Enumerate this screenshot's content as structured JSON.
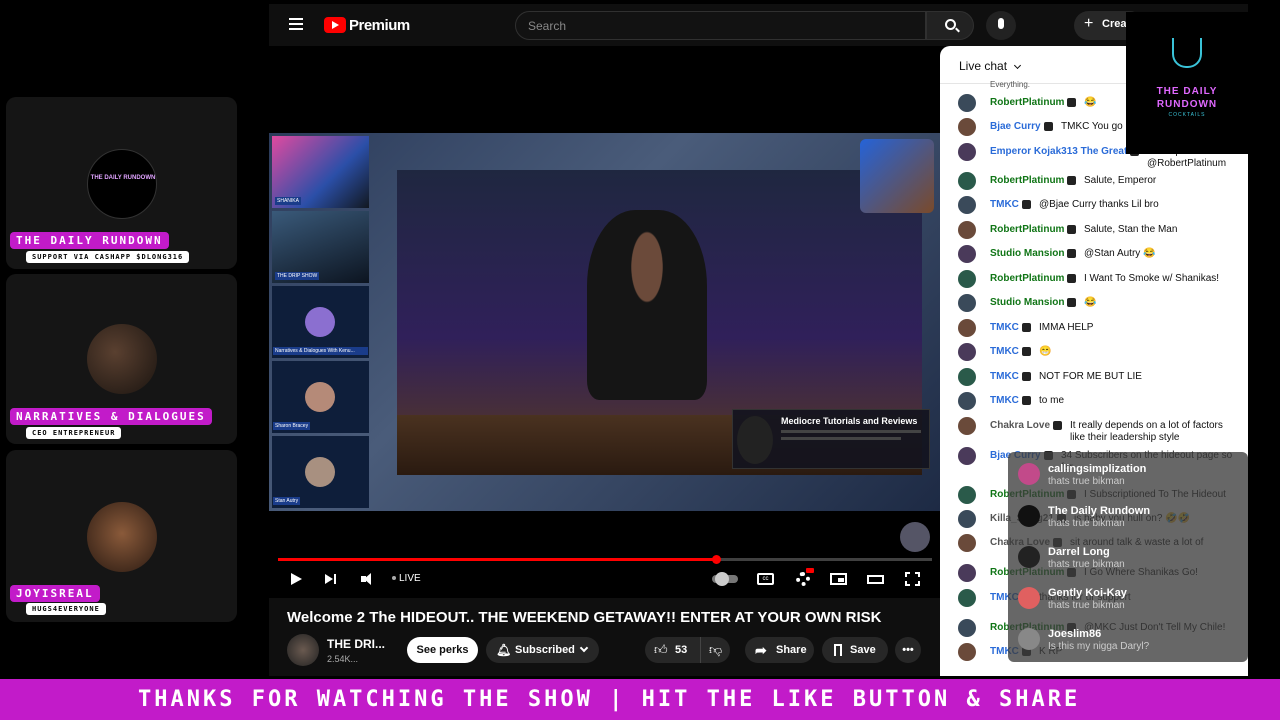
{
  "guests": [
    {
      "name": "THE DAILY RUNDOWN",
      "subtitle": "SUPPORT VIA CASHAPP $DLONG316",
      "avatar_text": "THE DAILY RUNDOWN"
    },
    {
      "name": "NARRATIVES & DIALOGUES",
      "subtitle": "CEO ENTREPRENEUR"
    },
    {
      "name": "JOYISREAL",
      "subtitle": "HUGS4EVERYONE"
    }
  ],
  "header": {
    "logo_text": "Premium",
    "search_placeholder": "Search",
    "create_label": "Create"
  },
  "overlay_logo": {
    "line1": "THE DAILY",
    "line2": "RUNDOWN",
    "line3": "COCKTAILS"
  },
  "video": {
    "live_label": "LIVE",
    "progress": 0.67,
    "side_tiles": [
      {
        "label": "SHANIKA"
      },
      {
        "label": "THE DRIP SHOW"
      },
      {
        "label": "Narratives & Dialogues With Kenu..."
      },
      {
        "label": "Sharon Bracey"
      },
      {
        "label": "Stan Autry"
      }
    ],
    "inset_card": {
      "title": "Mediocre Tutorials and Reviews"
    }
  },
  "meta": {
    "title": "Welcome 2 The HIDEOUT.. THE WEEKEND GETAWAY!! ENTER AT YOUR OWN RISK",
    "channel": "THE DRI...",
    "subs": "2.54K...",
    "perks_label": "See perks",
    "subscribed_label": "Subscribed",
    "likes": "53",
    "share_label": "Share",
    "save_label": "Save"
  },
  "chat": {
    "header": "Live chat",
    "top_fragment": "Everything.",
    "messages": [
      {
        "author": "RobertPlatinum",
        "text": "😂",
        "color": "#107516"
      },
      {
        "author": "Bjae Curry",
        "text": "TMKC You go",
        "color": "#2a6bd8"
      },
      {
        "author": "Emperor Kojak313 The Great",
        "text": "wassup doe @RobertPlatinum",
        "color": "#2a6bd8"
      },
      {
        "author": "RobertPlatinum",
        "text": "Salute, Emperor",
        "color": "#107516"
      },
      {
        "author": "TMKC",
        "text": "@Bjae Curry thanks Lil bro",
        "color": "#2a6bd8"
      },
      {
        "author": "RobertPlatinum",
        "text": "Salute, Stan the Man",
        "color": "#107516"
      },
      {
        "author": "Studio Mansion",
        "text": "@Stan Autry 😂",
        "color": "#107516"
      },
      {
        "author": "RobertPlatinum",
        "text": "I Want To Smoke w/ Shanikas!",
        "color": "#107516"
      },
      {
        "author": "Studio Mansion",
        "text": "😂",
        "color": "#107516"
      },
      {
        "author": "TMKC",
        "text": "IMMA HELP",
        "color": "#2a6bd8"
      },
      {
        "author": "TMKC",
        "text": "😁",
        "color": "#2a6bd8"
      },
      {
        "author": "TMKC",
        "text": "NOT FOR ME BUT LIE",
        "color": "#2a6bd8"
      },
      {
        "author": "TMKC",
        "text": "to me",
        "color": "#2a6bd8"
      },
      {
        "author": "Chakra Love",
        "text": "It really depends on a lot of factors like their leadership style",
        "color": "#555555"
      },
      {
        "author": "Bjae Curry",
        "text": "34 Subscribers on the hideout page so far",
        "color": "#2a6bd8"
      },
      {
        "author": "RobertPlatinum",
        "text": "I Subscriptioned To The Hideout",
        "color": "#107516"
      },
      {
        "author": "Killa_Swag21",
        "text": "is baby you hull on? 🤣🤣",
        "color": "#555555"
      },
      {
        "author": "Chakra Love",
        "text": "sit around talk & waste a lot of",
        "color": "#555555"
      },
      {
        "author": "RobertPlatinum",
        "text": "I Go Where Shanikas Go!",
        "color": "#107516"
      },
      {
        "author": "TMKC",
        "text": "thanks for ur support",
        "color": "#2a6bd8"
      },
      {
        "author": "RobertPlatinum",
        "text": "@MKC Just Don't Tell My Chile!",
        "color": "#107516"
      },
      {
        "author": "TMKC",
        "text": "K RP",
        "color": "#2a6bd8"
      }
    ]
  },
  "alerts": [
    {
      "name": "callingsimplization",
      "text": "thats true bikman"
    },
    {
      "name": "The Daily Rundown",
      "text": "thats true bikman"
    },
    {
      "name": "Darrel Long",
      "text": "thats true bikman"
    },
    {
      "name": "Gently Koi-Kay",
      "text": "thats true bikman"
    },
    {
      "name": "Joeslim86",
      "text": "Is this my nigga Daryl?"
    }
  ],
  "ticker": {
    "text": "THANKS FOR WATCHING THE SHOW | HIT THE LIKE BUTTON & SHARE"
  },
  "colors": {
    "brand_magenta": "#c21bc9",
    "youtube_red": "#ff0000"
  }
}
